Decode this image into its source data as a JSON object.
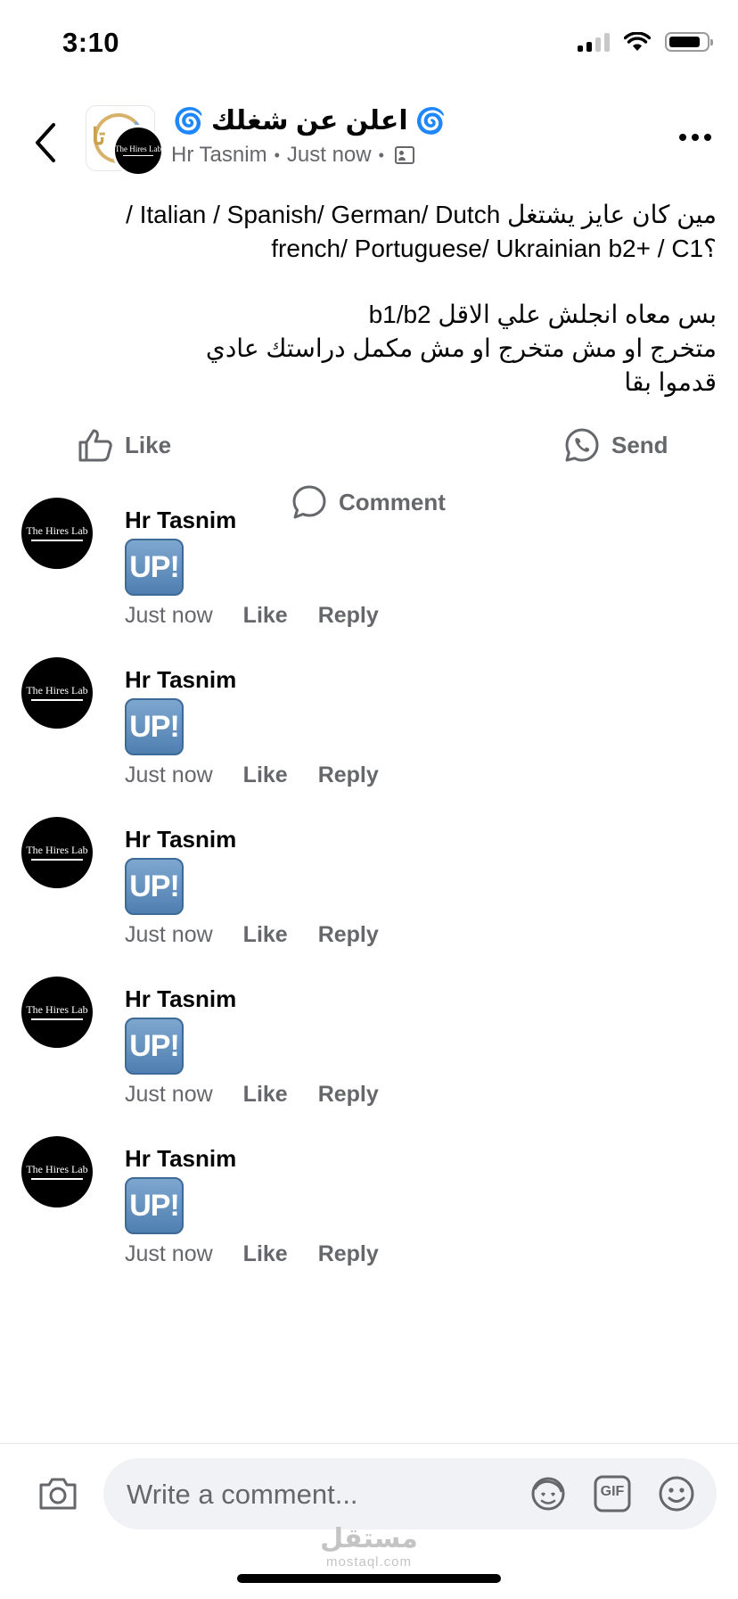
{
  "status_bar": {
    "time": "3:10"
  },
  "header": {
    "group_name": "اعلن عن شغلك",
    "author": "Hr Tasnim",
    "timestamp": "Just now",
    "avatar_label": "The Hires Lab"
  },
  "post": {
    "lines": [
      "مين كان عايز يشتغل Italian / Spanish/ German/ Dutch /",
      "french/ Portuguese/ Ukrainian b2+ / C1؟",
      "بس معاه انجلش علي الاقل b1/b2",
      "متخرج او مش متخرج او مش مكمل دراستك عادي",
      "قدموا بقا"
    ]
  },
  "actions": {
    "like": "Like",
    "comment": "Comment",
    "send": "Send"
  },
  "comments": [
    {
      "author": "Hr Tasnim",
      "sticker": "UP!",
      "time": "Just now",
      "like": "Like",
      "reply": "Reply"
    },
    {
      "author": "Hr Tasnim",
      "sticker": "UP!",
      "time": "Just now",
      "like": "Like",
      "reply": "Reply"
    },
    {
      "author": "Hr Tasnim",
      "sticker": "UP!",
      "time": "Just now",
      "like": "Like",
      "reply": "Reply"
    },
    {
      "author": "Hr Tasnim",
      "sticker": "UP!",
      "time": "Just now",
      "like": "Like",
      "reply": "Reply"
    },
    {
      "author": "Hr Tasnim",
      "sticker": "UP!",
      "time": "Just now",
      "like": "Like",
      "reply": "Reply"
    }
  ],
  "composer": {
    "placeholder": "Write a comment...",
    "gif_label": "GIF"
  },
  "watermark": {
    "arabic": "مستقل",
    "latin": "mostaql.com"
  },
  "colors": {
    "secondary_text": "#65676b",
    "accent": "#1877f2",
    "composer_bg": "#f0f2f5"
  }
}
